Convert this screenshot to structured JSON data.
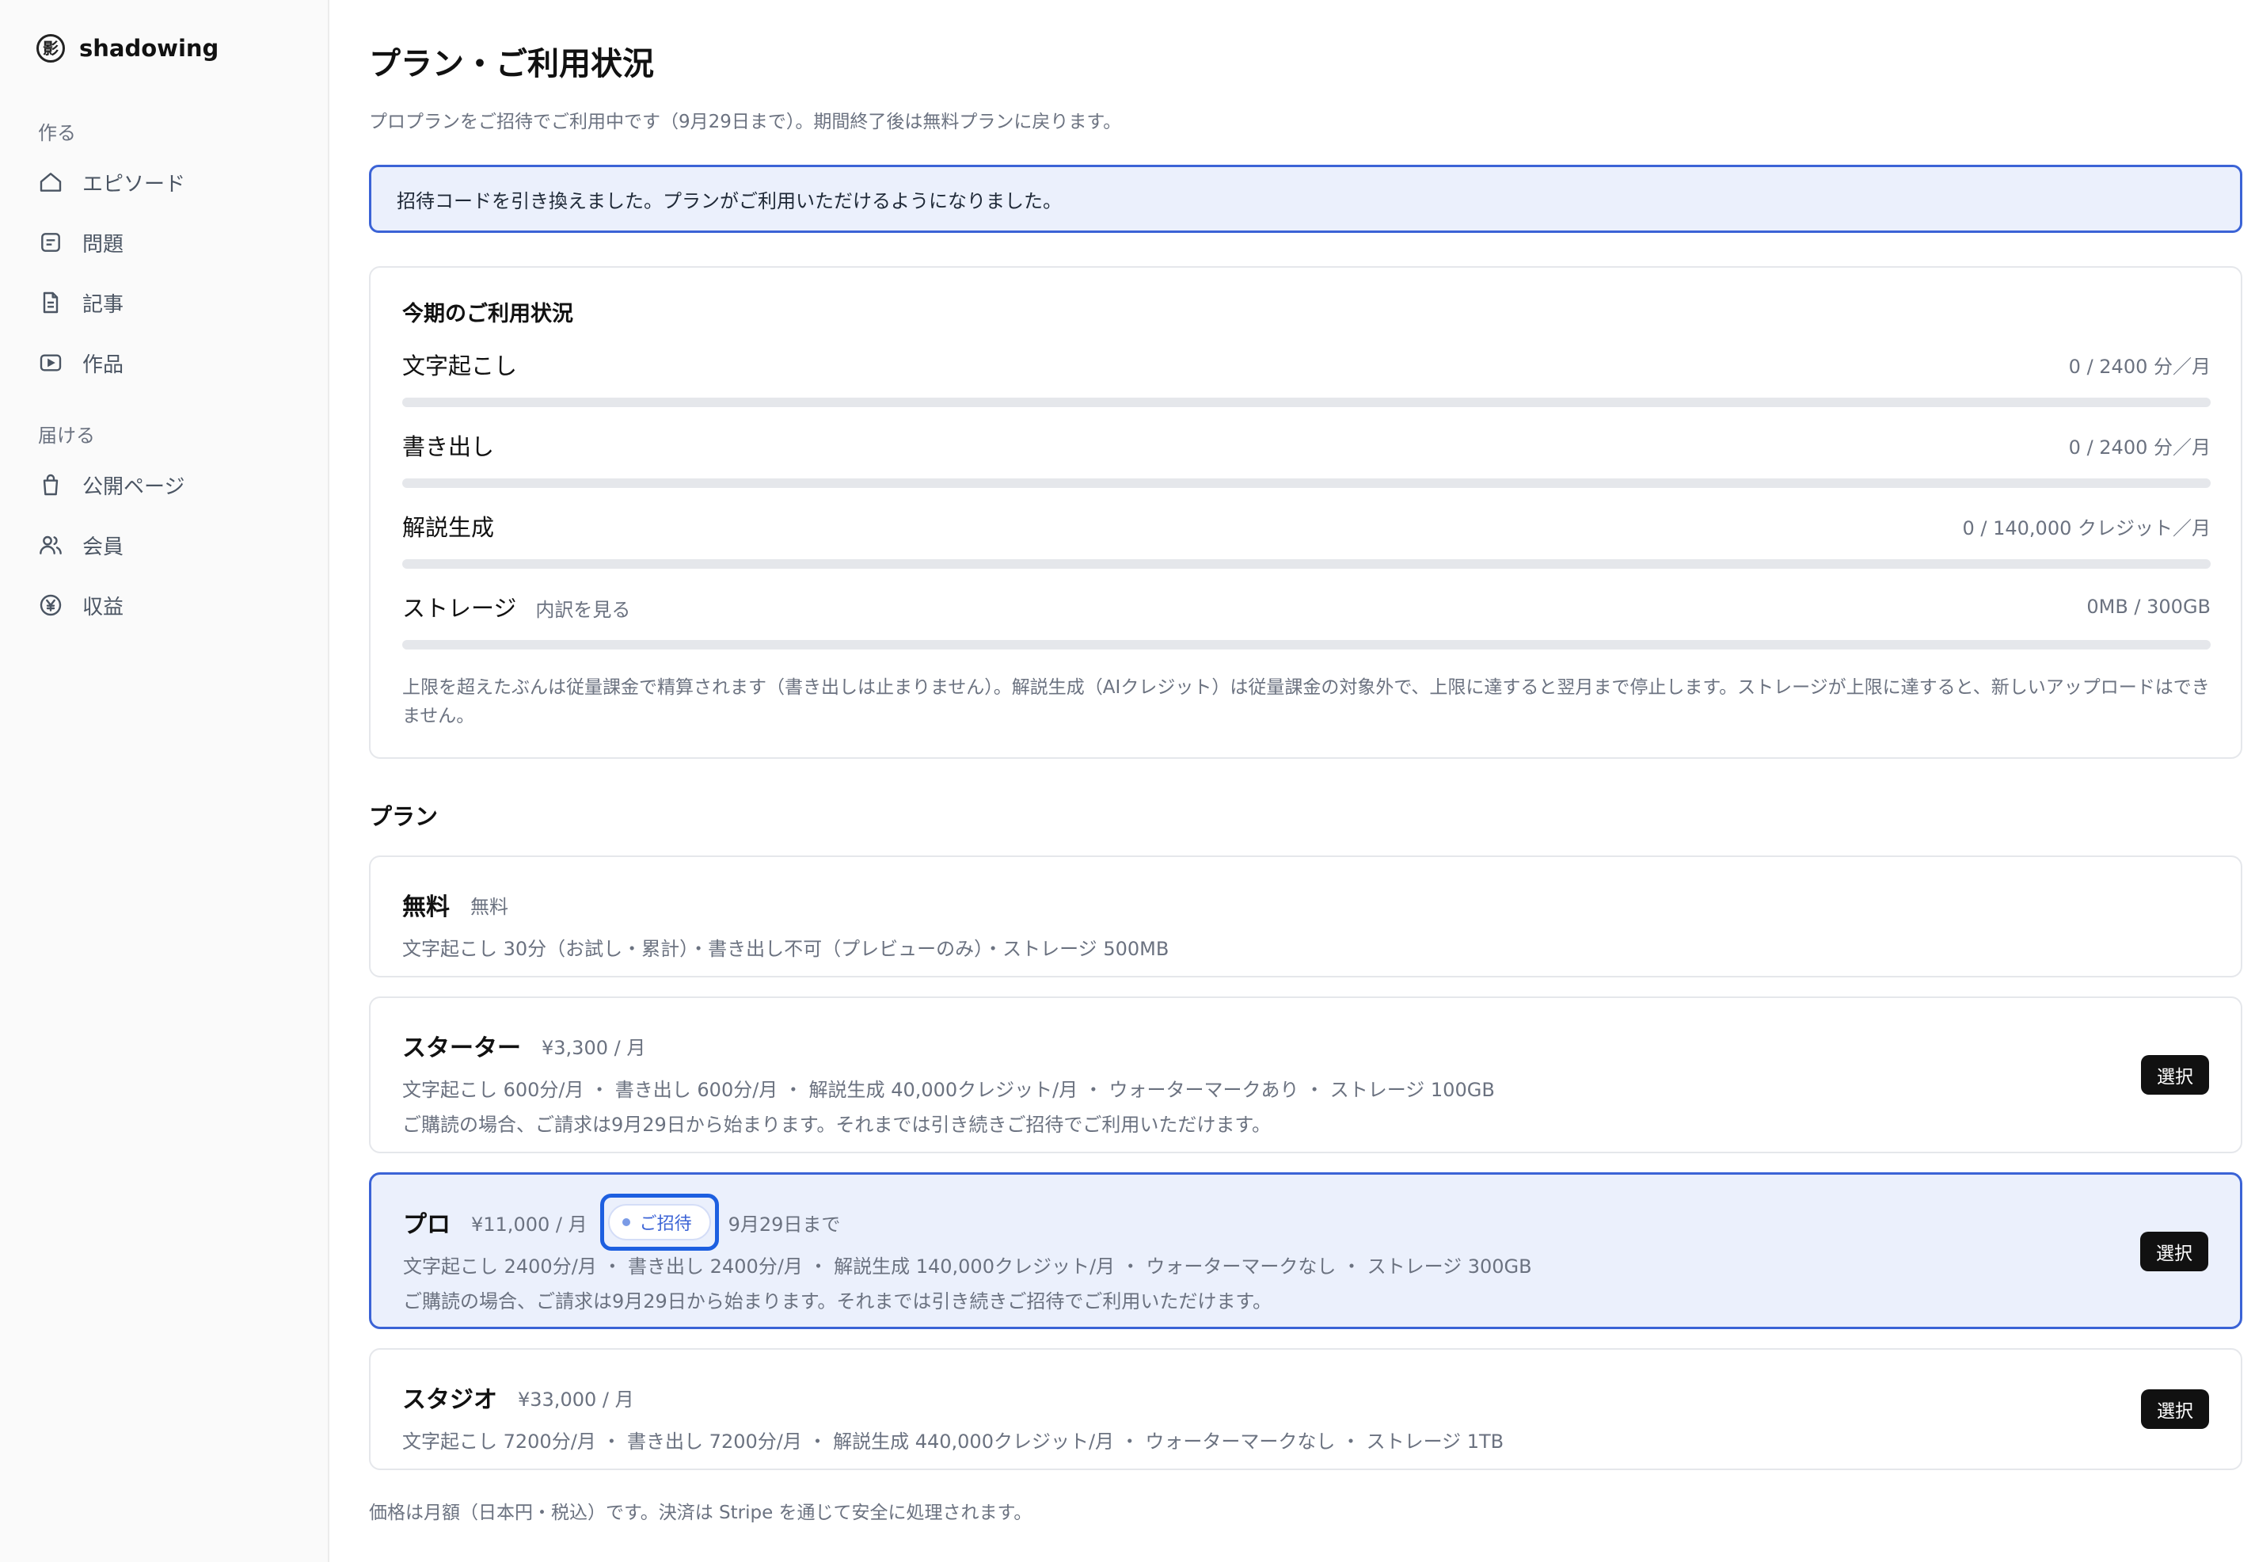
{
  "sidebar": {
    "brand_logo": "影",
    "brand_name": "shadowing",
    "sections": [
      {
        "label": "作る",
        "items": [
          {
            "label": "エピソード",
            "icon": "home-icon"
          },
          {
            "label": "問題",
            "icon": "list-icon"
          },
          {
            "label": "記事",
            "icon": "document-icon"
          },
          {
            "label": "作品",
            "icon": "play-icon"
          }
        ]
      },
      {
        "label": "届ける",
        "items": [
          {
            "label": "公開ページ",
            "icon": "bag-icon"
          },
          {
            "label": "会員",
            "icon": "users-icon"
          },
          {
            "label": "収益",
            "icon": "yen-icon"
          }
        ]
      }
    ]
  },
  "page": {
    "title": "プラン・ご利用状況",
    "subtitle": "プロプランをご招待でご利用中です（9月29日まで）。期間終了後は無料プランに戻ります。"
  },
  "notice": "招待コードを引き換えました。プランがご利用いただけるようになりました。",
  "usage": {
    "title": "今期のご利用状況",
    "meters": [
      {
        "label": "文字起こし",
        "value": "0 / 2400 分／月",
        "fraction": 0
      },
      {
        "label": "書き出し",
        "value": "0 / 2400 分／月",
        "fraction": 0
      },
      {
        "label": "解説生成",
        "value": "0 / 140,000 クレジット／月",
        "fraction": 0
      },
      {
        "label": "ストレージ",
        "link": "内訳を見る",
        "value": "0MB / 300GB",
        "fraction": 0
      }
    ],
    "note": "上限を超えたぶんは従量課金で精算されます（書き出しは止まりません）。解説生成（AIクレジット）は従量課金の対象外で、上限に達すると翌月まで停止します。ストレージが上限に達すると、新しいアップロードはできません。"
  },
  "plans": {
    "heading": "プラン",
    "select_label": "選択",
    "items": [
      {
        "name": "無料",
        "price": "無料",
        "features": "文字起こし 30分（お試し・累計）・書き出し不可（プレビューのみ）・ストレージ 500MB"
      },
      {
        "name": "スターター",
        "price": "¥3,300 / 月",
        "features": "文字起こし 600分/月 ・ 書き出し 600分/月 ・ 解説生成 40,000クレジット/月 ・ ウォーターマークあり ・ ストレージ 100GB",
        "billing_note": "ご購読の場合、ご請求は9月29日から始まります。それまでは引き続きご招待でご利用いただけます。"
      },
      {
        "name": "プロ",
        "price": "¥11,000 / 月",
        "badge": "ご招待",
        "until": "9月29日まで",
        "features": "文字起こし 2400分/月 ・ 書き出し 2400分/月 ・ 解説生成 140,000クレジット/月 ・ ウォーターマークなし ・ ストレージ 300GB",
        "billing_note": "ご購読の場合、ご請求は9月29日から始まります。それまでは引き続きご招待でご利用いただけます。"
      },
      {
        "name": "スタジオ",
        "price": "¥33,000 / 月",
        "features": "文字起こし 7200分/月 ・ 書き出し 7200分/月 ・ 解説生成 440,000クレジット/月 ・ ウォーターマークなし ・ ストレージ 1TB"
      }
    ]
  },
  "footer": "価格は月額（日本円・税込）です。決済は Stripe を通じて安全に処理されます。",
  "colors": {
    "accent": "#3b63d6",
    "accent_bg": "#ebf0fc",
    "invite_outline": "#1d5fe0",
    "button_bg": "#111111"
  }
}
